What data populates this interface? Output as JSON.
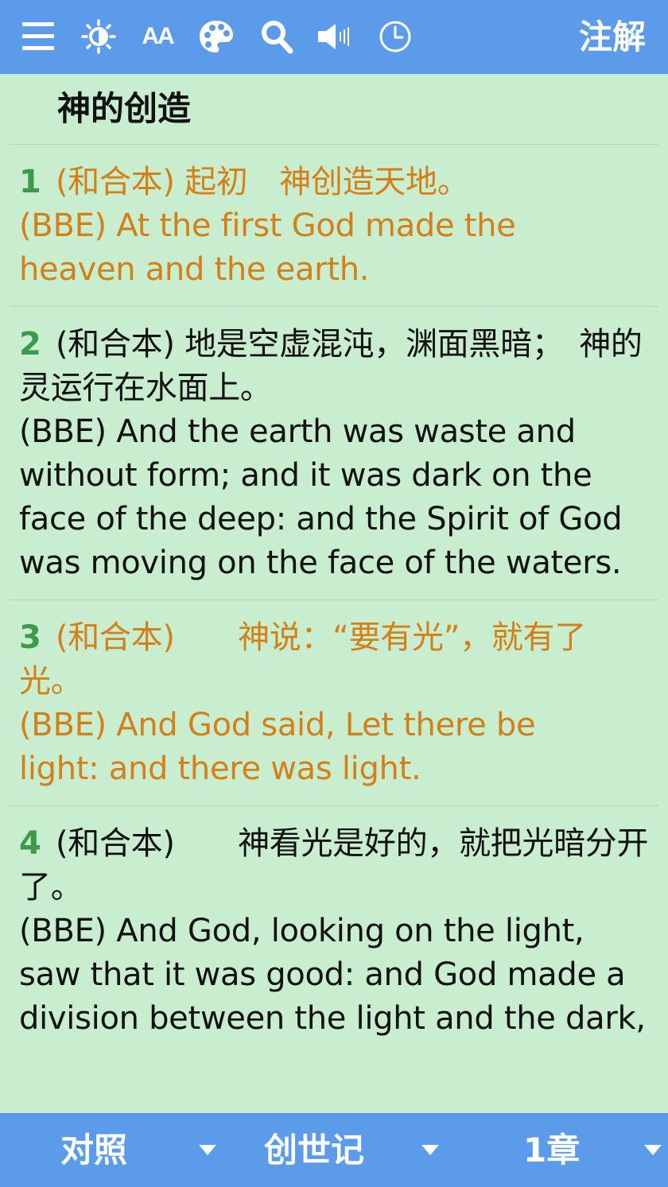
{
  "toolbar": {
    "icons": [
      "menu-icon",
      "brightness-icon",
      "font-size-icon",
      "palette-icon",
      "search-icon",
      "speaker-icon",
      "clock-icon"
    ],
    "font_size_glyph": "AA",
    "notes_label": "注解",
    "background_color": "#5b9bea"
  },
  "section": {
    "title": "神的创造"
  },
  "verses": [
    {
      "number": "1",
      "cuv": "(和合本) 起初　神创造天地。",
      "bbe": "(BBE) At the first God made the heaven and the earth.",
      "highlighted": true
    },
    {
      "number": "2",
      "cuv": "(和合本) 地是空虚混沌，渊面黑暗；　神的灵运行在水面上。",
      "bbe": "(BBE) And the earth was waste and without form; and it was dark on the face of the deep: and the Spirit of God was moving on the face of the waters.",
      "highlighted": false
    },
    {
      "number": "3",
      "cuv": "(和合本)　　神说：“要有光”，就有了光。",
      "bbe": "(BBE) And God said, Let there be light: and there was light.",
      "highlighted": true
    },
    {
      "number": "4",
      "cuv": "(和合本)　　神看光是好的，就把光暗分开了。",
      "bbe": "(BBE) And God, looking on the light, saw that it was good: and God made a division between the light and the dark,",
      "highlighted": false
    }
  ],
  "bottombar": {
    "compare_label": "对照",
    "book_label": "创世记",
    "chapter_label": "1章"
  },
  "colors": {
    "content_background": "#c9edcf",
    "highlight_text": "#d48019",
    "verse_number": "#3c9a4b",
    "bar": "#5b9bea"
  }
}
